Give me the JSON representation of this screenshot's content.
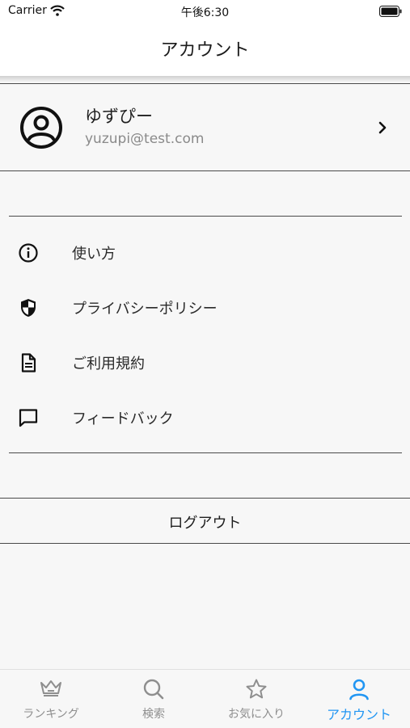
{
  "status_bar": {
    "carrier": "Carrier",
    "time": "午後6:30"
  },
  "nav": {
    "title": "アカウント"
  },
  "profile": {
    "name": "ゆずぴー",
    "email": "yuzupi@test.com"
  },
  "menu": {
    "items": [
      {
        "label": "使い方",
        "icon": "info-icon"
      },
      {
        "label": "プライバシーポリシー",
        "icon": "shield-icon"
      },
      {
        "label": "ご利用規約",
        "icon": "document-icon"
      },
      {
        "label": "フィードバック",
        "icon": "chat-icon"
      }
    ]
  },
  "logout": {
    "label": "ログアウト"
  },
  "tabs": {
    "active_color": "#2196f3",
    "items": [
      {
        "label": "ランキング",
        "icon": "crown-icon"
      },
      {
        "label": "検索",
        "icon": "search-icon"
      },
      {
        "label": "お気に入り",
        "icon": "star-icon"
      },
      {
        "label": "アカウント",
        "icon": "person-icon",
        "active": true
      }
    ]
  }
}
